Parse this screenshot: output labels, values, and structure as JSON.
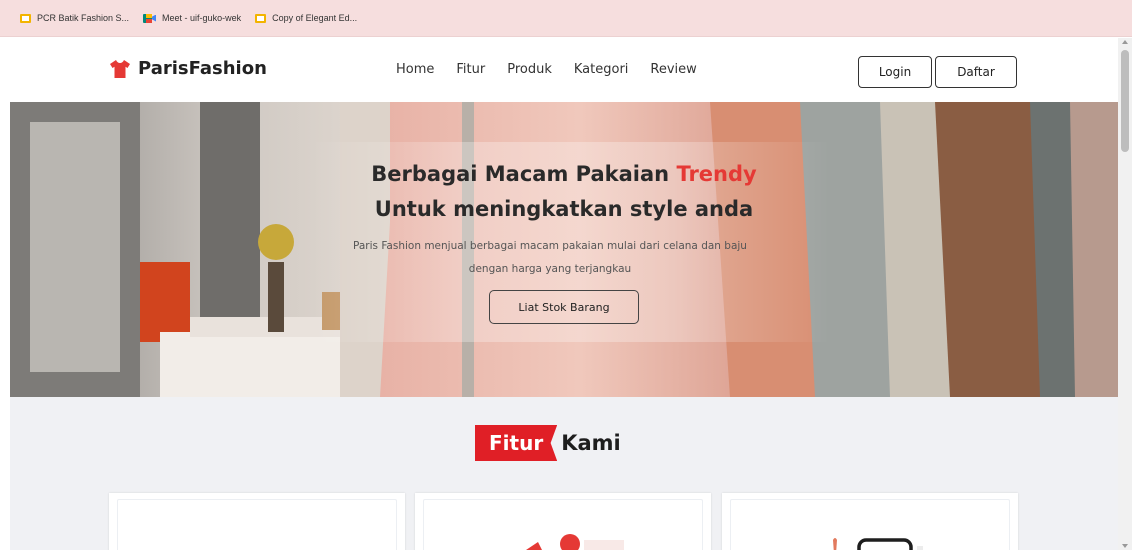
{
  "bookmarks": [
    {
      "label": "PCR Batik Fashion S...",
      "icon": "slides-icon"
    },
    {
      "label": "Meet - uif-guko-wek",
      "icon": "meet-icon"
    },
    {
      "label": "Copy of Elegant Ed...",
      "icon": "slides-icon"
    }
  ],
  "brand": {
    "name": "ParisFashion",
    "icon": "shirt-icon",
    "color": "#e53935"
  },
  "nav": {
    "links": [
      "Home",
      "Fitur",
      "Produk",
      "Kategori",
      "Review"
    ],
    "login_label": "Login",
    "daftar_label": "Daftar"
  },
  "hero": {
    "title_part1": "Berbagai Macam Pakaian ",
    "title_accent": "Trendy",
    "title_line2": "Untuk meningkatkan style anda",
    "description": "Paris Fashion menjual berbagai macam pakaian mulai dari celana dan baju dengan harga yang terjangkau",
    "cta_label": "Liat Stok Barang"
  },
  "features": {
    "ribbon_label": "Fitur",
    "heading_rest": "Kami",
    "accent_color": "#e01f26"
  }
}
